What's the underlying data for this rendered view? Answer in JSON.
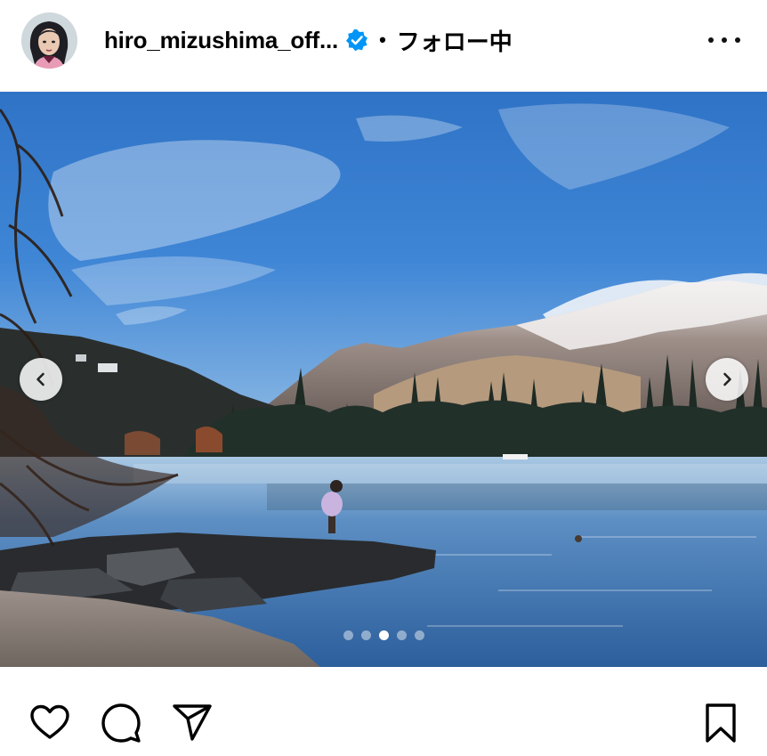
{
  "post": {
    "username": "hiro_mizushima_off...",
    "separator": "•",
    "follow_label": "フォロー中",
    "carousel": {
      "current": 3,
      "total": 5
    }
  },
  "icons": {
    "verified": "verified-badge-icon",
    "more": "more-options-icon",
    "prev": "chevron-left-icon",
    "next": "chevron-right-icon",
    "like": "heart-icon",
    "comment": "comment-icon",
    "share": "send-icon",
    "save": "bookmark-icon"
  },
  "colors": {
    "verified_blue": "#0095f6",
    "text": "#000000"
  }
}
